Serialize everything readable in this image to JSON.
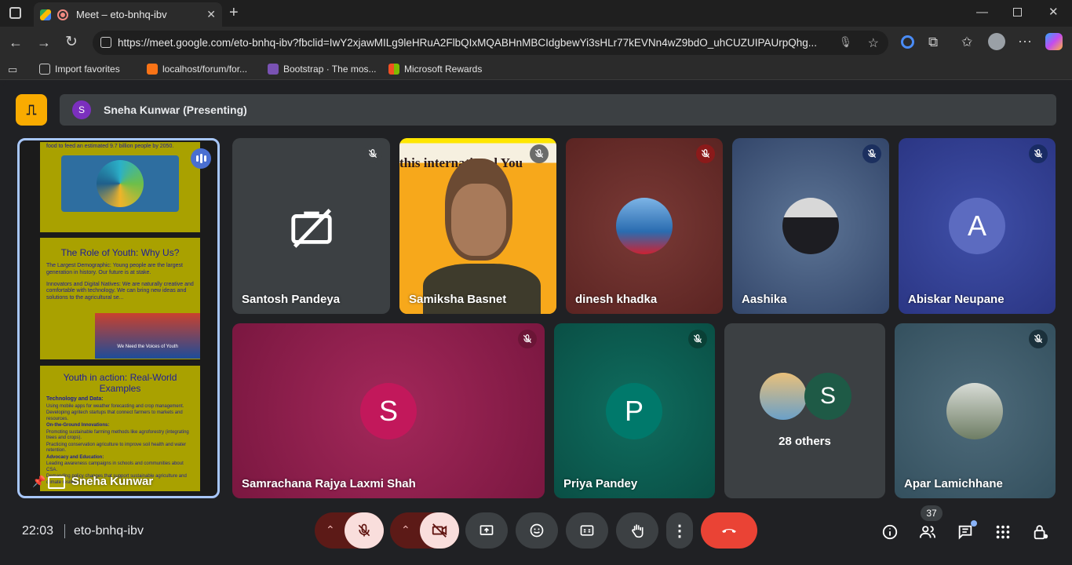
{
  "browser": {
    "tab_title": "Meet – eto-bnhq-ibv",
    "url": "https://meet.google.com/eto-bnhq-ibv?fbclid=IwY2xjawMILg9leHRuA2FlbQIxMQABHnMBCIdgbewYi3sHLr77kEVNn4wZ9bdO_uhCUZUIPAUrpQhg...",
    "bookmarks": [
      {
        "label": "Import favorites",
        "color": "#e3e3e3"
      },
      {
        "label": "localhost/forum/for...",
        "color": "#f97316"
      },
      {
        "label": "Bootstrap · The mos...",
        "color": "#7952b3"
      },
      {
        "label": "Microsoft Rewards",
        "color": "#f25022"
      }
    ]
  },
  "presenting": {
    "avatar_letter": "S",
    "banner": "Sneha Kunwar (Presenting)",
    "tile_name": "Sneha Kunwar",
    "slides": [
      {
        "lines": [
          "food to feed an estimated 9.7 billion people by 2050."
        ]
      },
      {
        "title": "The Role of Youth: Why Us?",
        "lines": [
          "The Largest Demographic: Young people are the largest generation in history. Our future is at stake.",
          "Innovators and Digital Natives: We are naturally creative and comfortable with technology. We can bring new ideas and solutions to the agricultural se..."
        ],
        "image_caption": "We Need the Voices of Youth"
      },
      {
        "title": "Youth in action: Real-World Examples",
        "lines": [
          "Technology and Data:",
          "Using mobile apps for weather forecasting and crop management.",
          "Developing agritech startups that connect farmers to markets and resources.",
          "On-the-Ground Innovations:",
          "Promoting sustainable farming methods like agroforestry (integrating trees and crops).",
          "Practicing conservation agriculture to improve soil health and water retention.",
          "Advocacy and Education:",
          "Leading awareness campaigns in schools and communities about CSA.",
          "Demanding policy changes that support sustainable agriculture and climate resilience."
        ]
      }
    ]
  },
  "participants": [
    {
      "name": "Santosh Pandeya",
      "camera_off": true,
      "mic": "muted"
    },
    {
      "name": "Samiksha Basnet",
      "video": true,
      "mic": "muted",
      "background_text": "this international You"
    },
    {
      "name": "dinesh khadka",
      "mic": "muted-red"
    },
    {
      "name": "Aashika",
      "mic": "muted"
    },
    {
      "name": "Abiskar Neupane",
      "avatar_letter": "A",
      "avatar_color": "#5c6bc0",
      "mic": "muted"
    },
    {
      "name": "Samrachana Rajya Laxmi Shah",
      "avatar_letter": "S",
      "avatar_color": "#c2185b",
      "mic": "muted"
    },
    {
      "name": "Priya Pandey",
      "avatar_letter": "P",
      "avatar_color": "#00796b",
      "mic": "muted"
    },
    {
      "name": "Apar Lamichhane",
      "mic": "muted"
    }
  ],
  "others": {
    "label": "28 others",
    "avatar_letter": "S",
    "avatar_color": "#1e5a46"
  },
  "footer": {
    "time": "22:03",
    "meeting_code": "eto-bnhq-ibv",
    "participant_count": "37"
  },
  "colors": {
    "end_call": "#ea4335",
    "muted_btn": "#f9dedc",
    "muted_arrow_bg": "#5c1a17",
    "present_yellow": "#f9ab00"
  }
}
